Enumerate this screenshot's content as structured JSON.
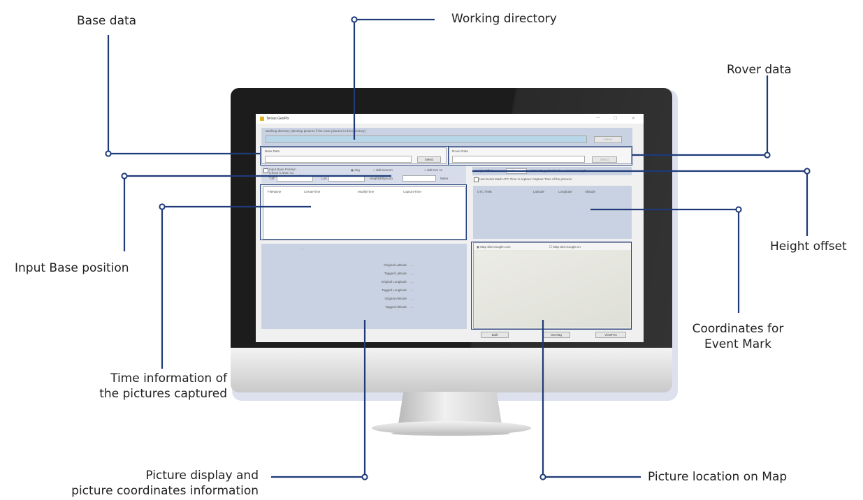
{
  "callouts": {
    "base_data": "Base data",
    "working_directory": "Working directory",
    "rover_data": "Rover data",
    "input_base_position": "Input Base position",
    "height_offset": "Height offset",
    "time_info_1": "Time information of",
    "time_info_2": "the pictures captured",
    "coords_event_1": "Coordinates for",
    "coords_event_2": "Event Mark",
    "picture_display_1": "Picture display and",
    "picture_display_2": "picture coordinates information",
    "picture_location": "Picture location on Map"
  },
  "app": {
    "title": "Tersus GeoPix",
    "working_dir_label": "Working directory (develop pictures if the rover pictures in this directory)",
    "select_label": "Select",
    "base_data_label": "Base Data",
    "rover_data_label": "Rover Data",
    "input_base_label": "Input Base Position (check it when no position in base data file)",
    "radio_deg": "deg",
    "radio_dms": "ddd.mmmm",
    "radio_dms2": "ddd mm ss",
    "lat_label": "Lat",
    "lon_label": "Lon",
    "height_label": "Height(Ellipsoid)",
    "meter_label": "Meter",
    "table_headers": [
      "FileName",
      "CreateTime",
      "ModifyTime",
      "CaptureTime"
    ],
    "height_offset_label": "Height Offset",
    "height_offset_value": "0.000",
    "height_offset_extra": "Meter Tagged Altitude = Antenna Height",
    "event_mark_label": "Use Event Mark UTC Time to replace Capture Time of the pictures",
    "event_headers": [
      "UTC TIME",
      "Latitude",
      "Longitude",
      "Altitude"
    ],
    "pic_placeholder": "...",
    "info_rows": [
      {
        "label": "Original Latitude",
        "value": "..."
      },
      {
        "label": "Tagged Latitude",
        "value": "..."
      },
      {
        "label": "Original Longitude",
        "value": "..."
      },
      {
        "label": "Tagged Longitude",
        "value": "..."
      },
      {
        "label": "Original Altitude",
        "value": "..."
      },
      {
        "label": "Tagged Altitude",
        "value": "..."
      }
    ],
    "map_option_1": "Map Site:Google.com",
    "map_option_2": "Map Site:Google.cn",
    "btn_built": "Built",
    "btn_geotag": "GeoTag",
    "btn_viewpos": "ViewPos"
  },
  "colors": {
    "callout_line": "#1e3a78",
    "panel": "#c9d2e2"
  }
}
